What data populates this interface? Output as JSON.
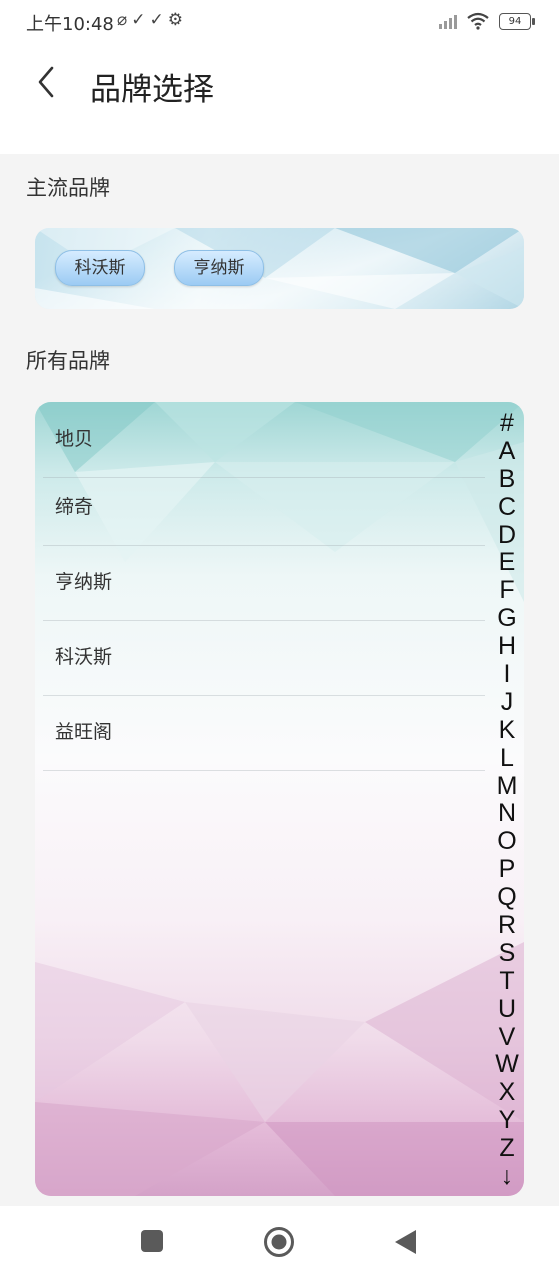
{
  "status_bar": {
    "time": "上午10:48",
    "left_icons": "⌀✓✓⚙",
    "battery": "94"
  },
  "header": {
    "title": "品牌选择"
  },
  "main_brands": {
    "section_title": "主流品牌",
    "chips": [
      "科沃斯",
      "亨纳斯"
    ]
  },
  "all_brands": {
    "section_title": "所有品牌",
    "items": [
      "地贝",
      "缔奇",
      "亨纳斯",
      "科沃斯",
      "益旺阁"
    ],
    "index": [
      "#",
      "A",
      "B",
      "C",
      "D",
      "E",
      "F",
      "G",
      "H",
      "I",
      "J",
      "K",
      "L",
      "M",
      "N",
      "O",
      "P",
      "Q",
      "R",
      "S",
      "T",
      "U",
      "V",
      "W",
      "X",
      "Y",
      "Z",
      "↓"
    ]
  },
  "colors": {
    "chip_blue": "#9ccbf3",
    "teal": "#9fd6d4",
    "pink": "#d4a2c8"
  }
}
